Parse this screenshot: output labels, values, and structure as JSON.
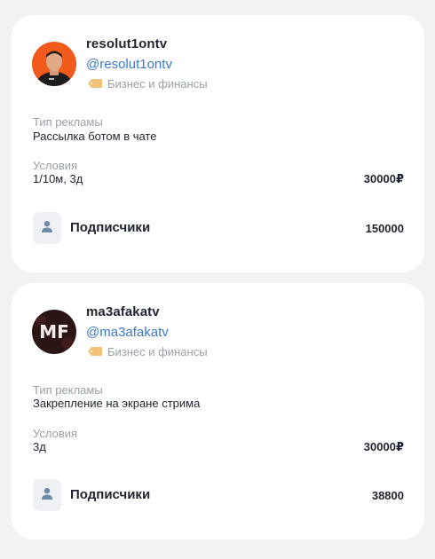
{
  "offers": [
    {
      "name": "resolut1ontv",
      "handle": "@resolut1ontv",
      "category": "Бизнес и финансы",
      "category_icon": "tag-icon",
      "ad_type_label": "Тип рекламы",
      "ad_type_value": "Рассылка ботом в чате",
      "conditions_label": "Условия",
      "conditions_value": "1/10м, 3д",
      "price": "30000₽",
      "subscribers_label": "Подписчики",
      "subscribers_count": "150000",
      "subscribers_icon": "user-icon"
    },
    {
      "name": "ma3afakatv",
      "handle": "@ma3afakatv",
      "category": "Бизнес и финансы",
      "category_icon": "tag-icon",
      "ad_type_label": "Тип рекламы",
      "ad_type_value": "Закрепление на экране стрима",
      "conditions_label": "Условия",
      "conditions_value": "3д",
      "price": "30000₽",
      "subscribers_label": "Подписчики",
      "subscribers_count": "38800",
      "subscribers_icon": "user-icon",
      "avatar_text": "MF"
    }
  ],
  "colors": {
    "background": "#f1f2f4",
    "card": "#ffffff",
    "handle": "#3a78c9",
    "muted": "#9aa0a8",
    "text": "#1f2430",
    "avatar_1_bg": "#f05a1a",
    "avatar_2_bg": "#2a1414"
  }
}
